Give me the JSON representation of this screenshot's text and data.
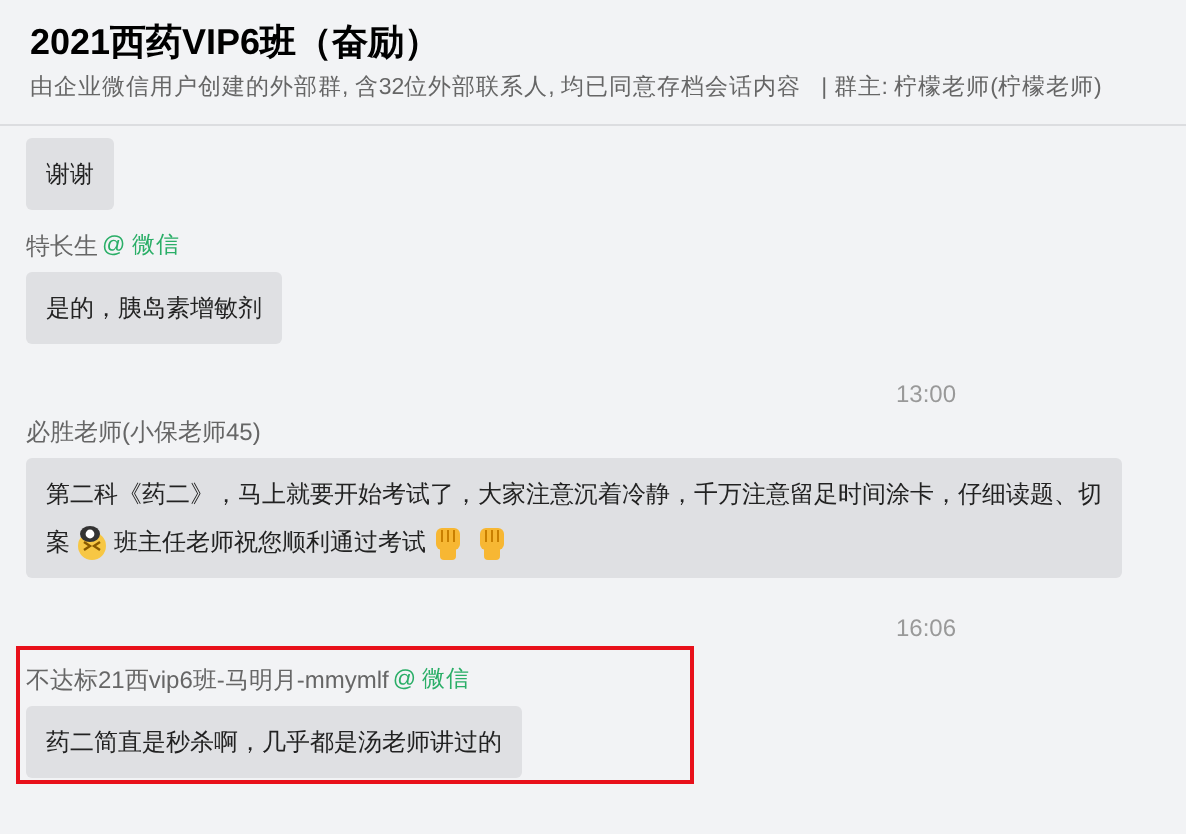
{
  "header": {
    "title": "2021西药VIP6班（奋励）",
    "subtitle": "由企业微信用户创建的外部群, 含32位外部联系人, 均已同意存档会话内容",
    "owner": "| 群主: 柠檬老师(柠檬老师)"
  },
  "messages": [
    {
      "kind": "message",
      "highlighted": false,
      "lines": [
        [
          {
            "kind": "text",
            "text": "谢谢"
          }
        ]
      ]
    },
    {
      "kind": "message",
      "sender": "特长生",
      "source": "@ 微信",
      "highlighted": false,
      "lines": [
        [
          {
            "kind": "text",
            "text": "是的，胰岛素增敏剂"
          }
        ]
      ]
    },
    {
      "kind": "time",
      "text": "13:00"
    },
    {
      "kind": "message",
      "sender": "必胜老师(小保老师45)",
      "highlighted": false,
      "lines": [
        [
          {
            "kind": "text",
            "text": "第二科《药二》，马上就要开始考试了，大家注意沉着冷静，千万注意留足时间涂卡，仔细读题、切"
          }
        ],
        [
          {
            "kind": "text",
            "text": "案"
          },
          {
            "kind": "emoji_face"
          },
          {
            "kind": "text",
            "text": "班主任老师祝您顺利通过考试"
          },
          {
            "kind": "emoji_fist"
          },
          {
            "kind": "emoji_fist"
          }
        ]
      ]
    },
    {
      "kind": "time",
      "text": "16:06"
    },
    {
      "kind": "message",
      "sender": "不达标21西vip6班-马明月-mmymlf",
      "source": "@ 微信",
      "highlighted": true,
      "lines": [
        [
          {
            "kind": "text",
            "text": "药二简直是秒杀啊，几乎都是汤老师讲过的"
          }
        ]
      ]
    }
  ]
}
